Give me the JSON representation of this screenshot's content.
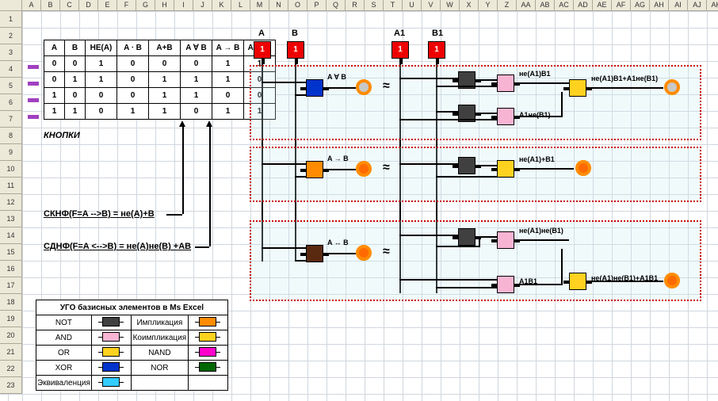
{
  "columns": [
    "A",
    "B",
    "C",
    "D",
    "E",
    "F",
    "G",
    "H",
    "I",
    "J",
    "K",
    "L",
    "M",
    "N",
    "O",
    "P",
    "Q",
    "R",
    "S",
    "T",
    "U",
    "V",
    "W",
    "X",
    "Y",
    "Z",
    "AA",
    "AB",
    "AC",
    "AD",
    "AE",
    "AF",
    "AG",
    "AH",
    "AI",
    "AJ",
    "AK"
  ],
  "rows": [
    "1",
    "2",
    "3",
    "4",
    "5",
    "6",
    "7",
    "8",
    "9",
    "10",
    "11",
    "12",
    "13",
    "14",
    "15",
    "16",
    "17",
    "18",
    "19",
    "20",
    "21",
    "22",
    "23"
  ],
  "truth": {
    "headers": [
      "A",
      "B",
      "НЕ(A)",
      "A ⋅ B",
      "A+B",
      "A ∀ B",
      "A → B",
      "A ↔ B"
    ],
    "rows": [
      [
        "0",
        "0",
        "1",
        "0",
        "0",
        "0",
        "1",
        "1"
      ],
      [
        "0",
        "1",
        "1",
        "0",
        "1",
        "1",
        "1",
        "0"
      ],
      [
        "1",
        "0",
        "0",
        "0",
        "1",
        "1",
        "0",
        "0"
      ],
      [
        "1",
        "1",
        "0",
        "1",
        "1",
        "0",
        "1",
        "1"
      ]
    ]
  },
  "buttons_label": "КНОПКИ",
  "formulas": {
    "sknf": "СКНФ(F=A -->B) = не(A)+B",
    "sdnf": "СДНФ(F=A <-->B) = не(A)не(B) +AB"
  },
  "legend": {
    "title": "УГО базисных элементов в Ms Excel",
    "rows": [
      {
        "l": "NOT",
        "c": "#404040",
        "r": "Импликация",
        "rc": "#ff8c00"
      },
      {
        "l": "AND",
        "c": "#f7b5d3",
        "r": "Коимпликация",
        "rc": "#ffd21f"
      },
      {
        "l": "OR",
        "c": "#ffd21f",
        "r": "NAND",
        "rc": "#ff00cc"
      },
      {
        "l": "XOR",
        "c": "#0033cc",
        "r": "NOR",
        "rc": "#006600"
      },
      {
        "l": "Эквиваленция",
        "c": "#33ccff",
        "r": "",
        "rc": ""
      }
    ]
  },
  "circuit": {
    "inputs": [
      "A",
      "B",
      "A1",
      "B1"
    ],
    "input_value": "1",
    "approx": "≈",
    "gate_labels": {
      "xor": "A ∀ B",
      "impl": "A → B",
      "equiv": "A ↔ B",
      "ne_a1_b1": "не(A1)B1",
      "a1_ne_b1": "A1не(B1)",
      "sum1": "не(A1)B1+A1не(B1)",
      "ne_a1_plus_b1": "не(A1)+B1",
      "ne_a1_ne_b1": "не(A1)не(B1)",
      "a1b1": "A1B1",
      "sum2": "не(A1)не(B1)+A1B1"
    },
    "colors": {
      "not": "#404040",
      "and": "#f7b5d3",
      "or": "#ffd21f",
      "xor": "#0033cc",
      "impl": "#ff8c00",
      "equiv": "#5a2a10"
    }
  }
}
